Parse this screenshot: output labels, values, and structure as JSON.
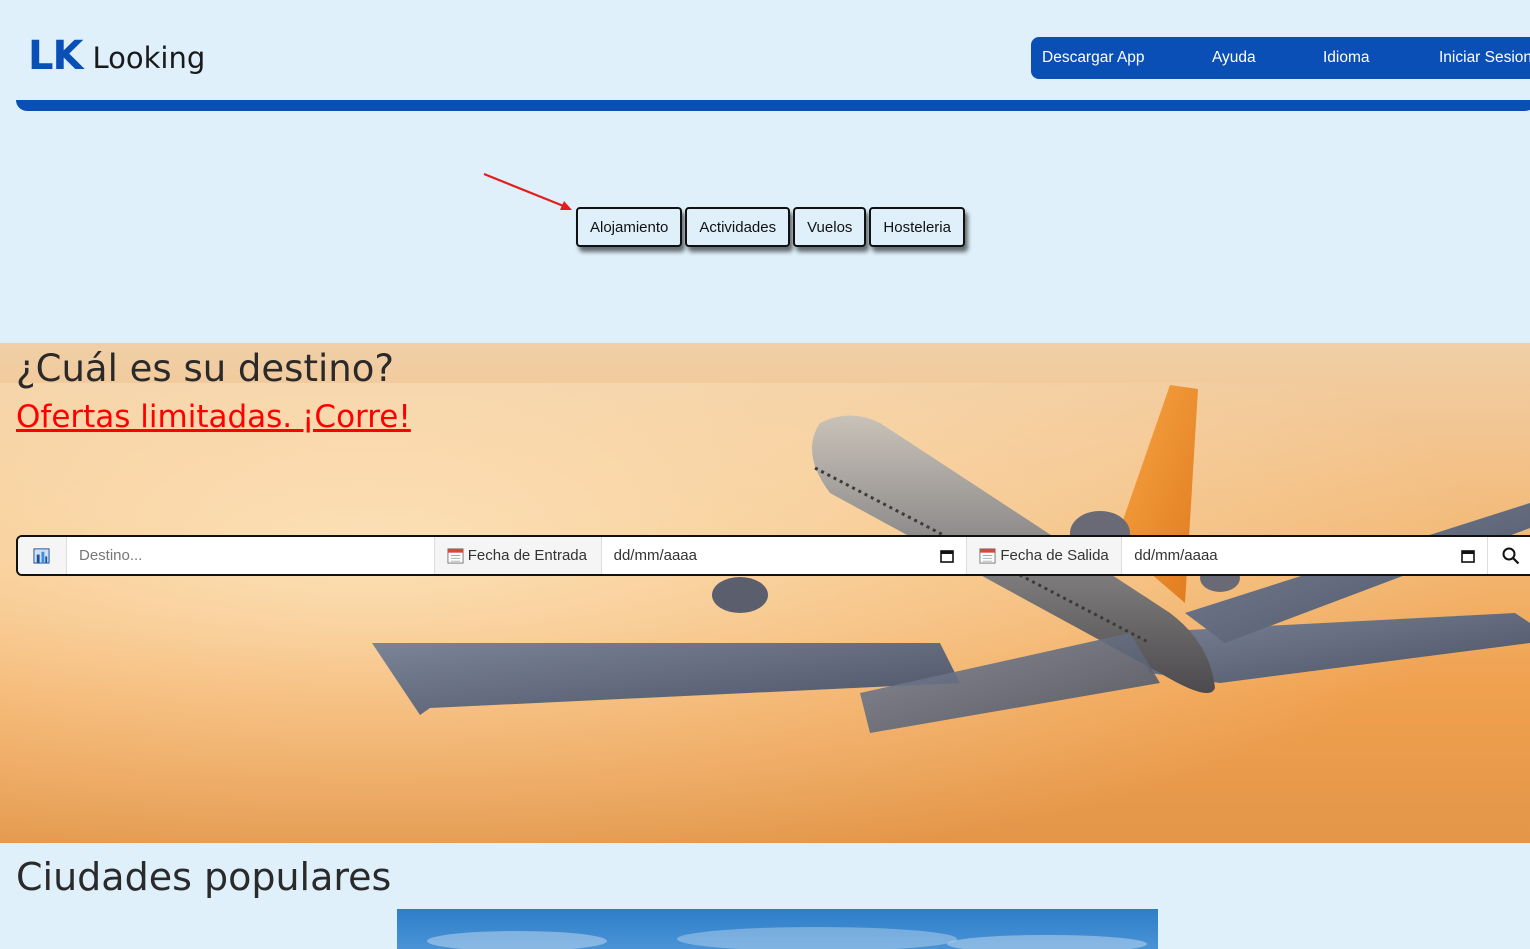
{
  "header": {
    "logo_mark": "LK",
    "logo_text": "Looking",
    "nav": [
      {
        "label": "Descargar App"
      },
      {
        "label": "Ayuda"
      },
      {
        "label": "Idioma"
      },
      {
        "label": "Iniciar Sesion"
      }
    ]
  },
  "categories": [
    {
      "label": "Alojamiento"
    },
    {
      "label": "Actividades"
    },
    {
      "label": "Vuelos"
    },
    {
      "label": "Hosteleria"
    }
  ],
  "hero": {
    "title": "¿Cuál es su destino?",
    "offer_link": "Ofertas limitadas. ¡Corre!"
  },
  "search": {
    "destination_placeholder": "Destino...",
    "checkin_label": "Fecha de Entrada",
    "checkin_value": "dd/mm/aaaa",
    "checkout_label": "Fecha de Salida",
    "checkout_value": "dd/mm/aaaa"
  },
  "popular": {
    "title": "Ciudades populares"
  },
  "colors": {
    "brand": "#0a4fb5",
    "background": "#dff0fb",
    "offer": "#ff0000"
  }
}
